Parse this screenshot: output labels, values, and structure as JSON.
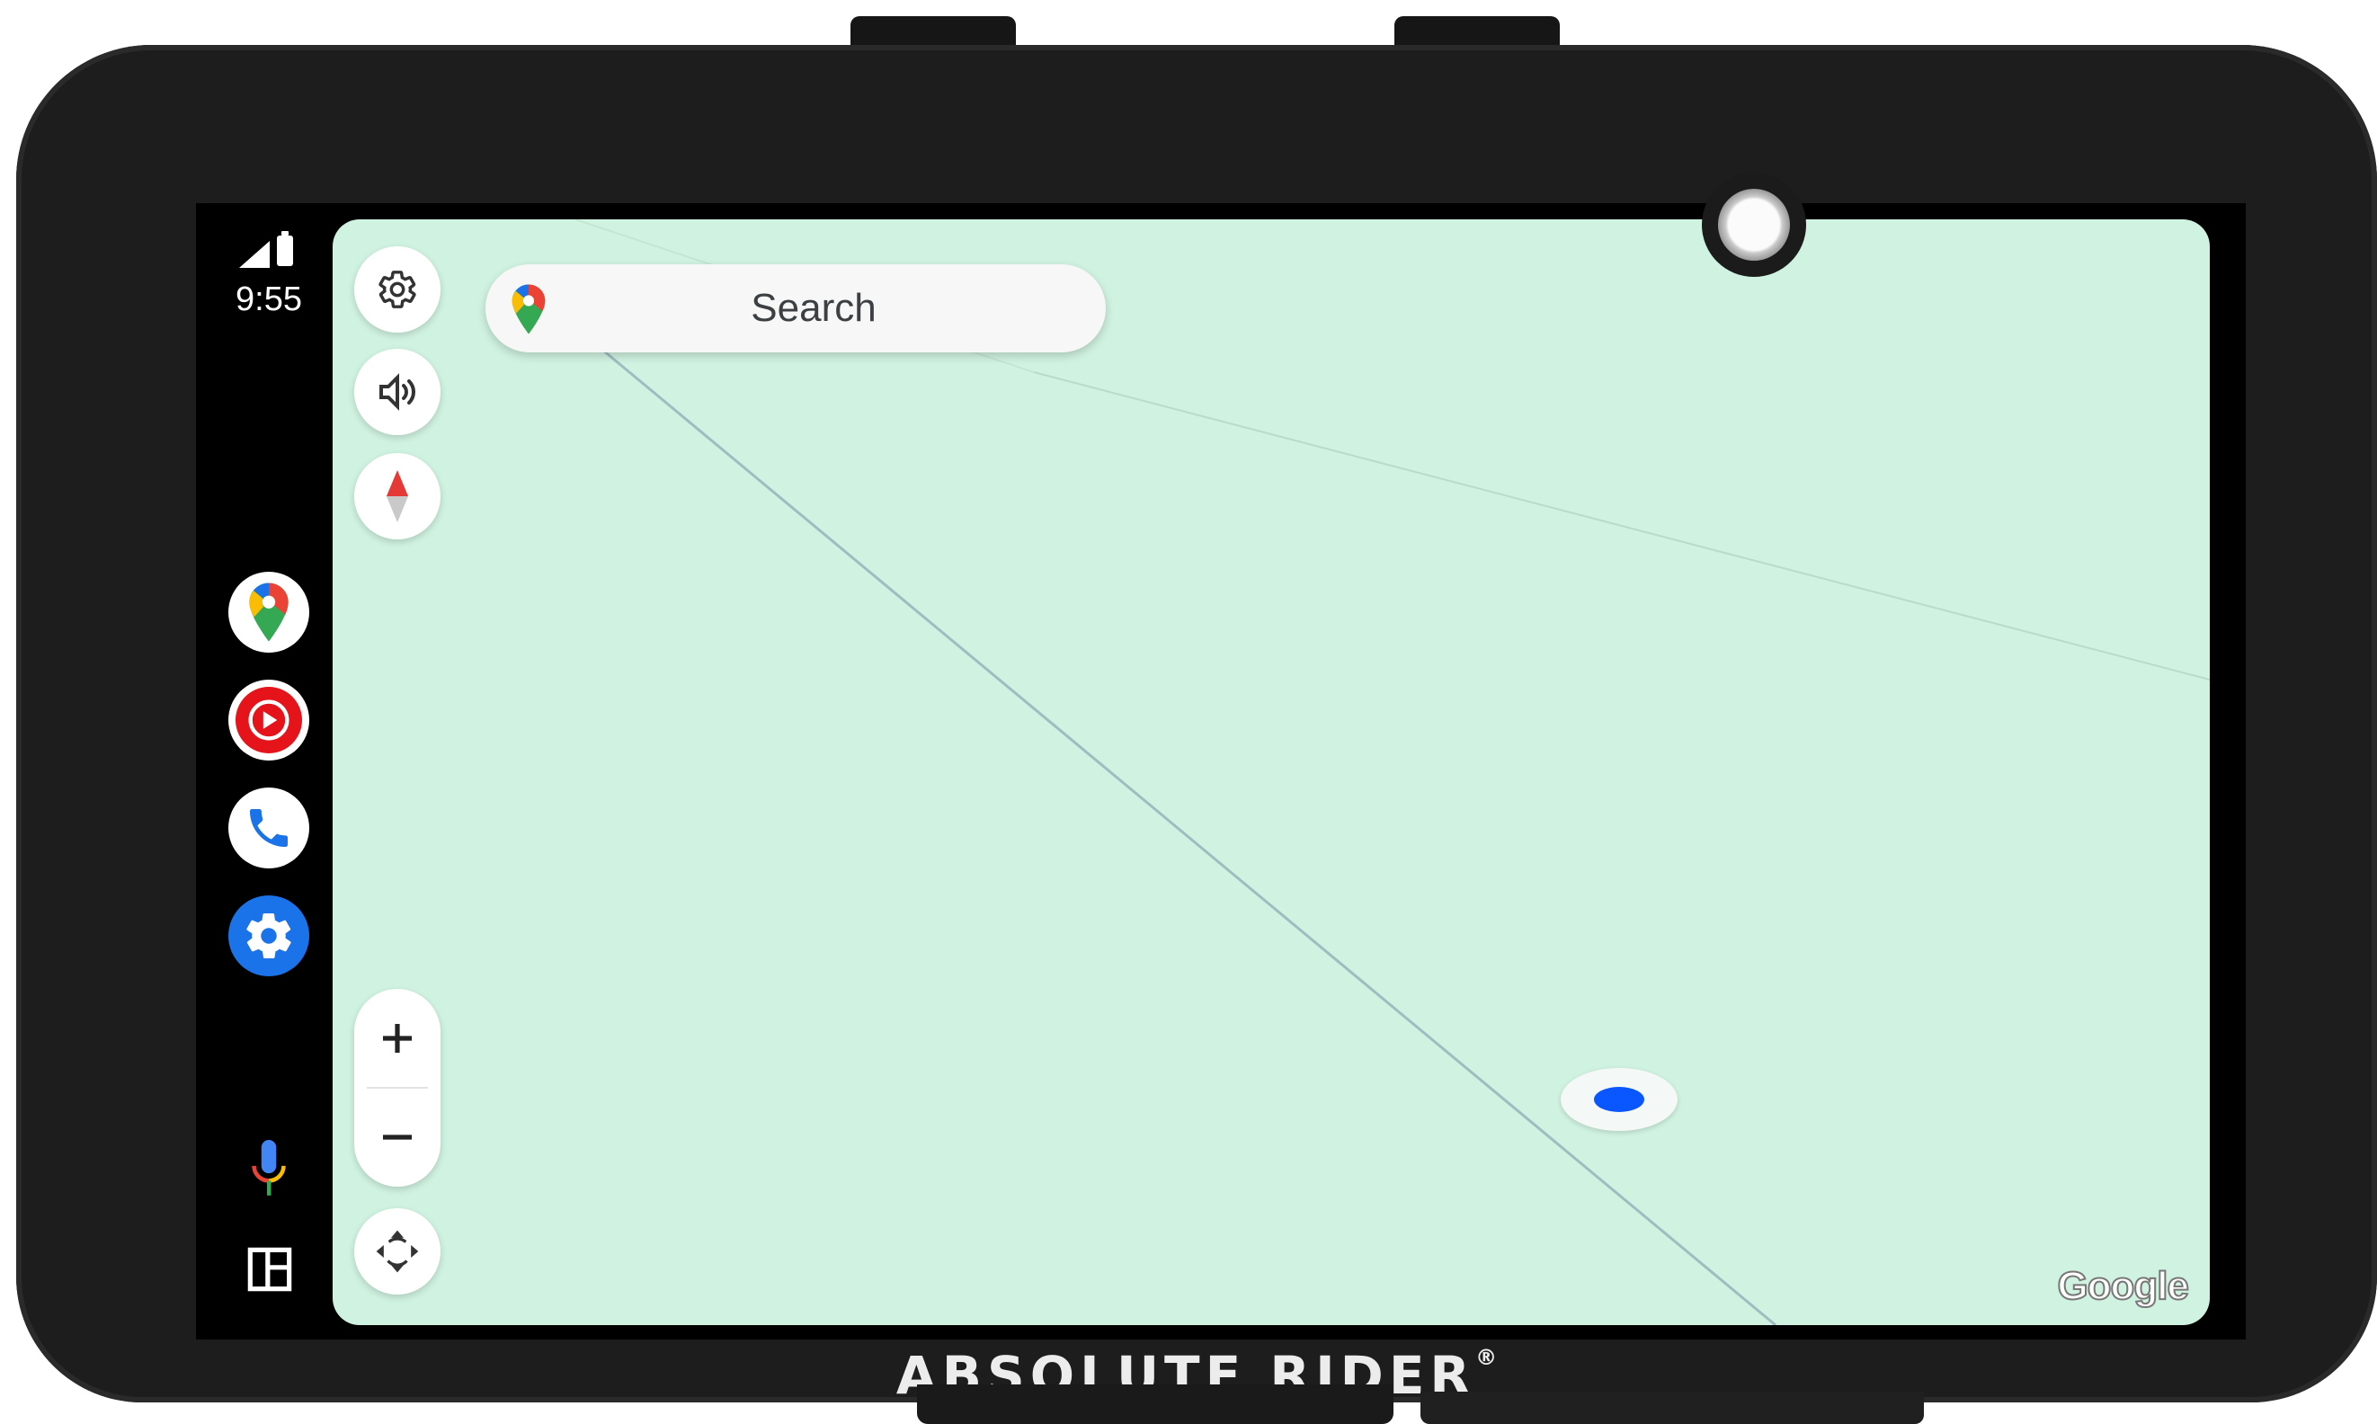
{
  "status_bar": {
    "time": "9:55"
  },
  "app_rail": {
    "items": [
      {
        "name": "Maps"
      },
      {
        "name": "YouTube Music"
      },
      {
        "name": "Phone"
      },
      {
        "name": "Settings"
      }
    ]
  },
  "map": {
    "search": {
      "placeholder": "Search"
    },
    "attribution": "Google"
  },
  "device": {
    "brand": "ABSOLUTE RIDER",
    "brand_mark": "®"
  },
  "colors": {
    "map_background": "#d0f2e0",
    "settings_accent": "#1a73e8",
    "location_dot": "#0b57ff",
    "rail_background": "#000000"
  },
  "icons": [
    "signal-icon",
    "battery-icon",
    "google-maps-icon",
    "youtube-music-icon",
    "phone-icon",
    "settings-icon",
    "microphone-icon",
    "dashboard-layout-icon",
    "gear-icon",
    "volume-icon",
    "compass-icon",
    "zoom-in-icon",
    "zoom-out-icon",
    "pan-icon"
  ]
}
